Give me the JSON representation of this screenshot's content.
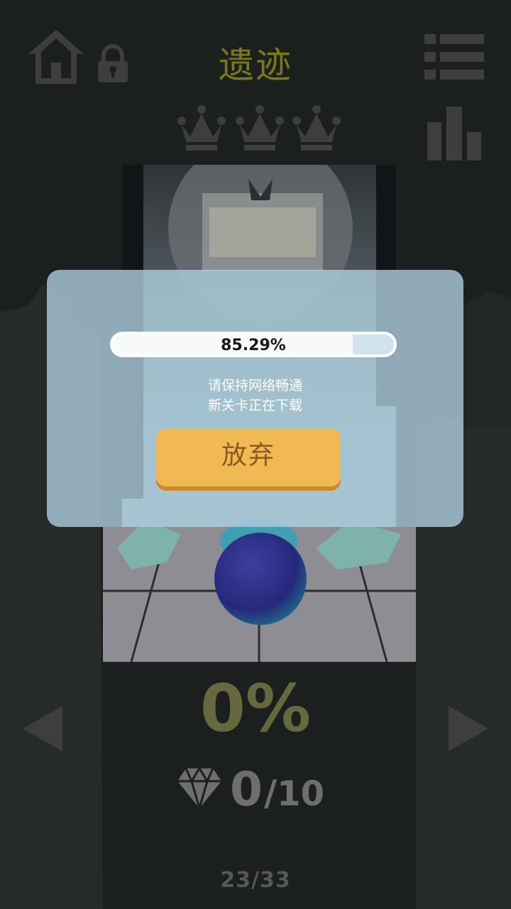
{
  "header": {
    "title": "遗迹",
    "home_icon": "home-icon",
    "lock_icon": "lock-icon",
    "menu_icon": "menu-list-icon",
    "stats_icon": "stats-bar-icon",
    "title_color": "#787a18"
  },
  "crowns": {
    "earned": 0,
    "total": 3,
    "icon": "crown-icon"
  },
  "level": {
    "progress": "0%",
    "gems_collected": "0",
    "gems_separator": "/",
    "gems_total": "10",
    "index": "23/33",
    "gem_icon": "diamond-icon"
  },
  "navigation": {
    "prev_icon": "arrow-left-icon",
    "next_icon": "arrow-right-icon"
  },
  "download_dialog": {
    "progress_text": "85.29%",
    "progress_fraction": 0.8529,
    "message_line1": "请保持网络畅通",
    "message_line2": "新关卡正在下载",
    "abandon_label": "放弃",
    "button_color": "#f1b954"
  }
}
